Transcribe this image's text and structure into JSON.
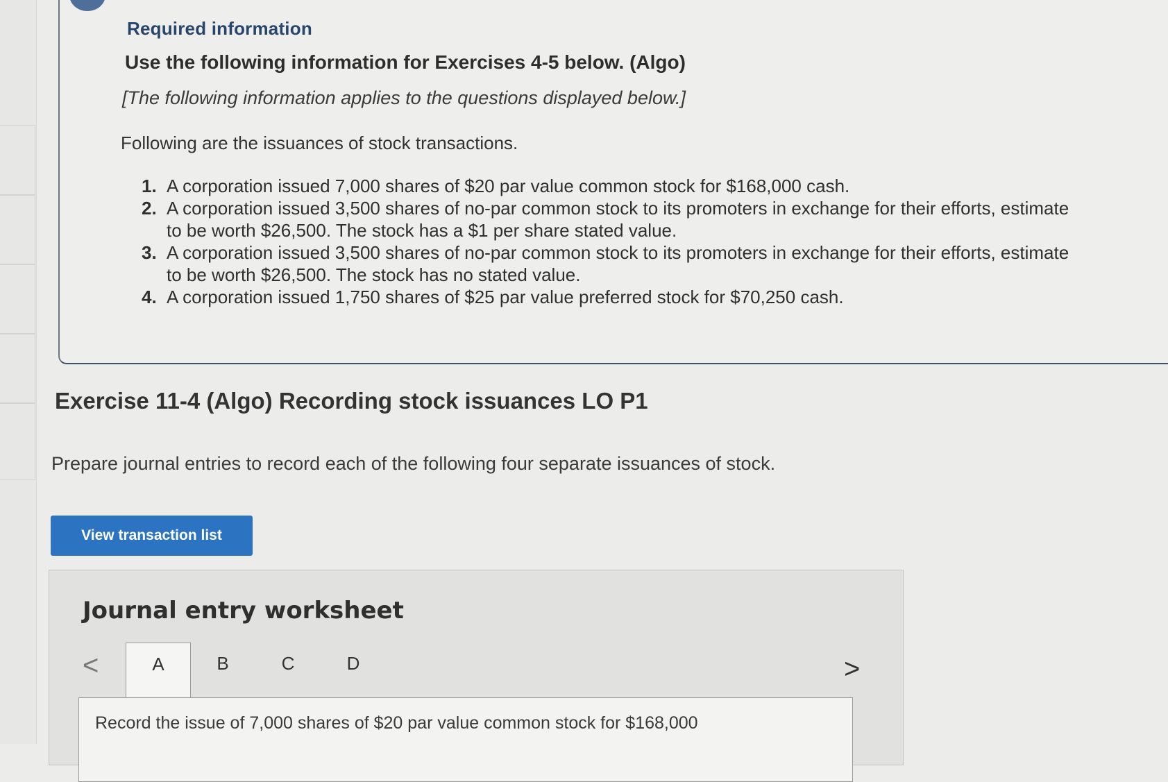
{
  "required_info": {
    "heading": "Required information",
    "use_following": "Use the following information for Exercises 4-5 below. (Algo)",
    "applies_note": "[The following information applies to the questions displayed below.]",
    "following_are": "Following are the issuances of stock transactions.",
    "transactions": [
      {
        "num": "1.",
        "line1": "A corporation issued 7,000 shares of $20 par value common stock for $168,000 cash.",
        "line2": ""
      },
      {
        "num": "2.",
        "line1": "A corporation issued 3,500 shares of no-par common stock to its promoters in exchange for their efforts, estimate",
        "line2": "to be worth $26,500. The stock has a $1 per share stated value."
      },
      {
        "num": "3.",
        "line1": "A corporation issued 3,500 shares of no-par common stock to its promoters in exchange for their efforts, estimate",
        "line2": "to be worth $26,500. The stock has no stated value."
      },
      {
        "num": "4.",
        "line1": "A corporation issued 1,750 shares of $25 par value preferred stock for $70,250 cash.",
        "line2": ""
      }
    ]
  },
  "exercise": {
    "title": "Exercise 11-4 (Algo) Recording stock issuances LO P1",
    "prompt": "Prepare journal entries to record each of the following four separate issuances of stock.",
    "view_button": "View transaction list"
  },
  "worksheet": {
    "title": "Journal entry worksheet",
    "prev_glyph": "<",
    "next_glyph": ">",
    "tabs": [
      "A",
      "B",
      "C",
      "D"
    ],
    "active_tab": "A",
    "entry_text": "Record the issue of 7,000 shares of $20 par value common stock for $168,000"
  },
  "colors": {
    "accent_button": "#2c74c2",
    "heading_blue": "#28466b",
    "page_bg": "#ececea"
  }
}
